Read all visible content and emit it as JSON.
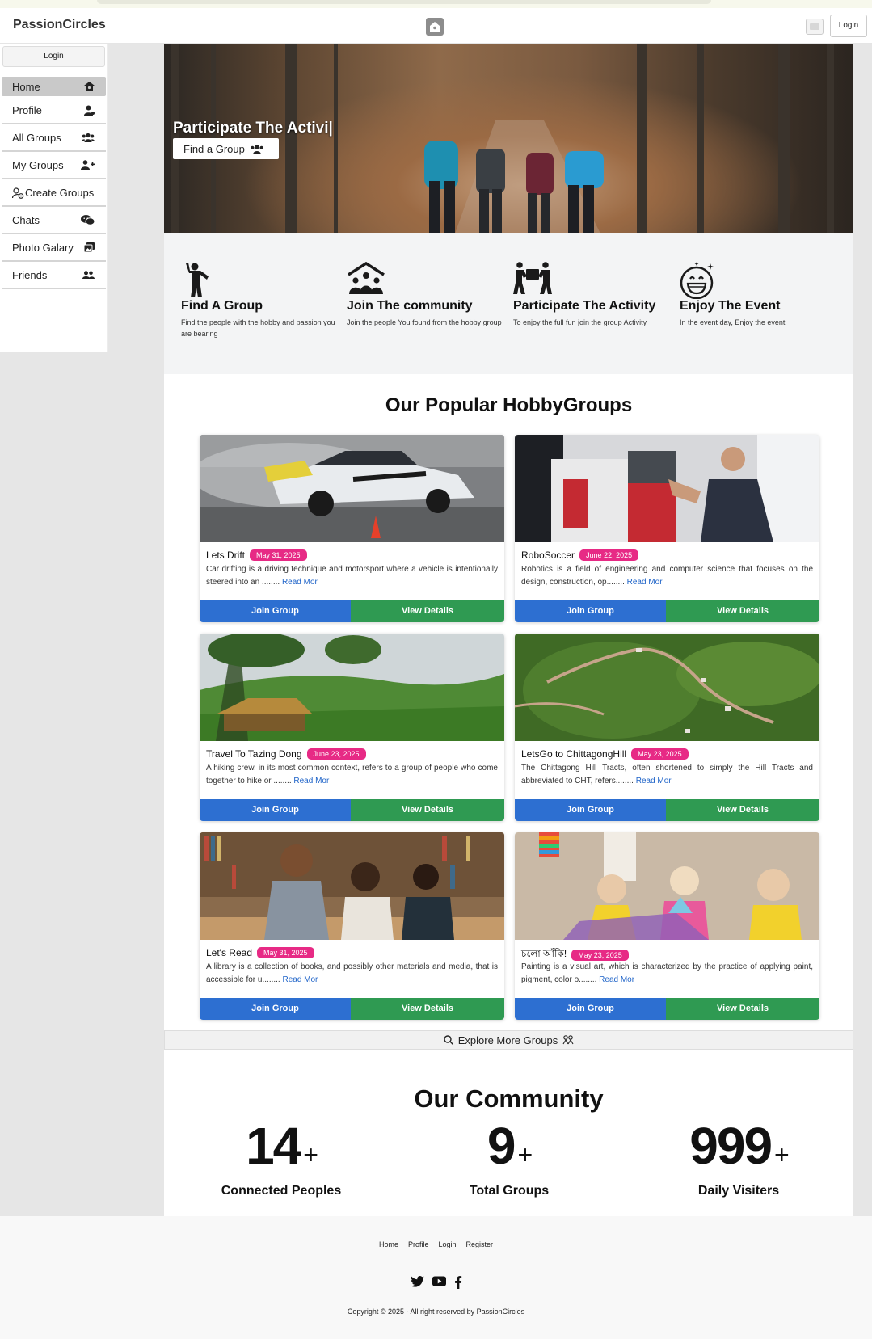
{
  "brand": "PassionCircles",
  "nav": {
    "login_label": "Login"
  },
  "sidebar": {
    "login_label": "Login",
    "items": [
      {
        "label": "Home",
        "icon": "home-icon"
      },
      {
        "label": "Profile",
        "icon": "user-icon"
      },
      {
        "label": "All Groups",
        "icon": "users-icon"
      },
      {
        "label": "My Groups",
        "icon": "user-plus-icon"
      },
      {
        "label": "Create Groups",
        "icon": "user-cog-icon"
      },
      {
        "label": "Chats",
        "icon": "chat-icon"
      },
      {
        "label": "Photo Galary",
        "icon": "images-icon"
      },
      {
        "label": "Friends",
        "icon": "friends-icon"
      }
    ]
  },
  "hero": {
    "heading": "Participate The Activi|",
    "button_label": "Find a Group"
  },
  "features": [
    {
      "title": "Find A Group",
      "text": "Find the people with the hobby and passion you are bearing"
    },
    {
      "title": "Join The community",
      "text": "Join the people You found from the hobby group"
    },
    {
      "title": "Participate The Activity",
      "text": "To enjoy the full fun join the group Activity"
    },
    {
      "title": "Enjoy The Event",
      "text": "In the event day, Enjoy the event"
    }
  ],
  "popular": {
    "title": "Our Popular HobbyGroups",
    "join_label": "Join Group",
    "details_label": "View Details",
    "read_more": "Read Mor",
    "groups": [
      {
        "name": "Lets Drift",
        "date": "May 31, 2025",
        "desc": "Car drifting is a driving technique and motorsport where a vehicle is intentionally steered into an ........ "
      },
      {
        "name": "RoboSoccer",
        "date": "June 22, 2025",
        "desc": "Robotics is a field of engineering and computer science that focuses on the design, construction, op........ "
      },
      {
        "name": "Travel To Tazing Dong",
        "date": "June 23, 2025",
        "desc": "A hiking crew, in its most common context, refers to a group of people who come together to hike or ........ "
      },
      {
        "name": "LetsGo to ChittagongHill",
        "date": "May 23, 2025",
        "desc": "The Chittagong Hill Tracts, often shortened to simply the Hill Tracts and abbreviated to CHT, refers........ "
      },
      {
        "name": "Let's Read",
        "date": "May 31, 2025",
        "desc": "A library is a collection of books, and possibly other materials and media, that is accessible for u........ "
      },
      {
        "name": "চলো আঁকি!",
        "date": "May 23, 2025",
        "desc": "Painting is a visual art, which is characterized by the practice of applying paint, pigment, color o........ "
      }
    ]
  },
  "explore_label": "Explore More Groups",
  "community": {
    "title": "Our Community",
    "stats": [
      {
        "value": "14",
        "suffix": "+",
        "label": "Connected Peoples"
      },
      {
        "value": "9",
        "suffix": "+",
        "label": "Total Groups"
      },
      {
        "value": "999",
        "suffix": "+",
        "label": "Daily Visiters"
      }
    ]
  },
  "footer": {
    "links": [
      "Home",
      "Profile",
      "Login",
      "Register"
    ],
    "social": [
      "twitter-icon",
      "youtube-icon",
      "facebook-icon"
    ],
    "copyright": "Copyright © 2025 - All right reserved by PassionCircles"
  },
  "colors": {
    "join": "#2d6fd1",
    "details": "#2f9a52",
    "badge": "#e72a85",
    "link": "#1e63c8"
  }
}
